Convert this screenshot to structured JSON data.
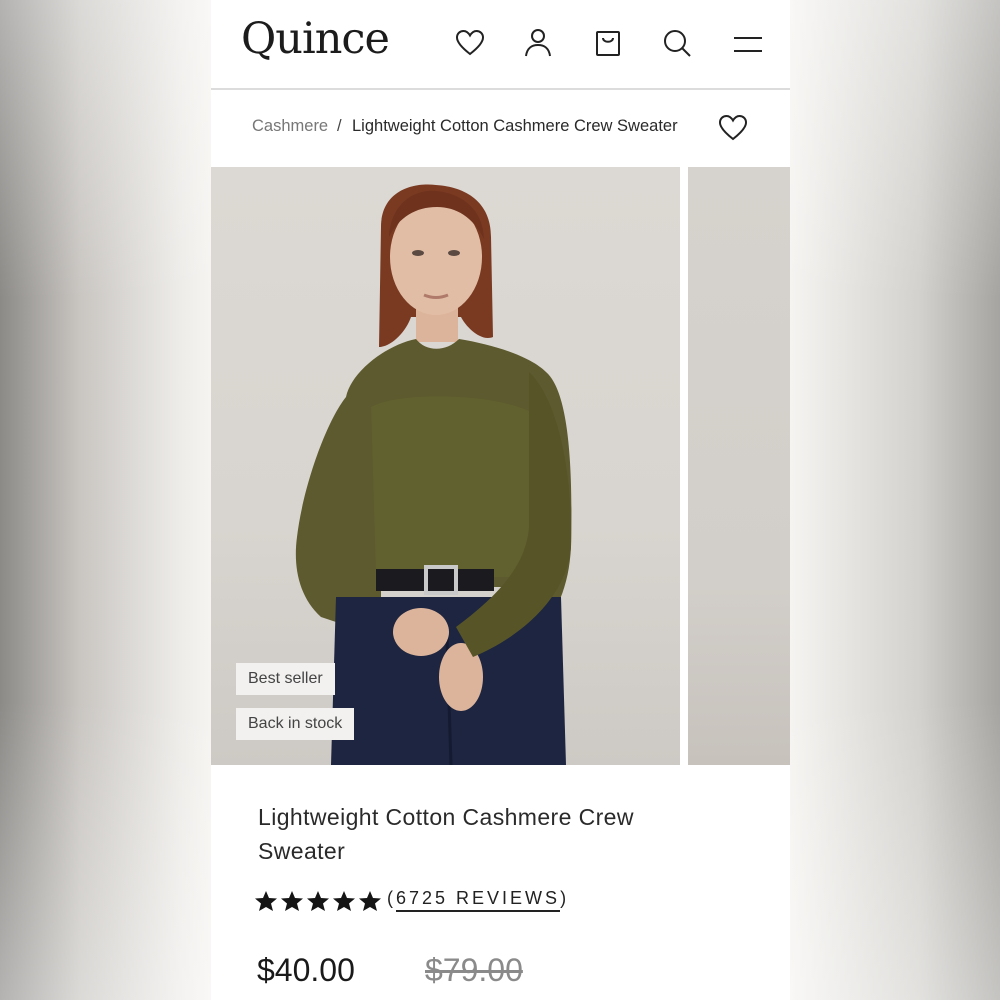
{
  "brand": {
    "logo_text": "Quince"
  },
  "header": {
    "icons": [
      "heart-icon",
      "account-icon",
      "bag-icon",
      "search-icon",
      "menu-icon"
    ]
  },
  "breadcrumb": {
    "root": "Cashmere",
    "separator": "/",
    "current": "Lightweight Cotton Cashmere Crew Sweater"
  },
  "gallery": {
    "badges": [
      "Best seller",
      "Back in stock"
    ]
  },
  "product": {
    "title": "Lightweight Cotton Cashmere Crew Sweater",
    "rating_stars": 5,
    "reviews_open": "(",
    "reviews_text": "6725 REVIEWS",
    "reviews_close": ")",
    "price": "$40.00",
    "compare_price": "$79.00"
  },
  "colors": {
    "sweater": "#5c5a2e",
    "pants": "#1e2540",
    "background": "#d9d5d0"
  }
}
